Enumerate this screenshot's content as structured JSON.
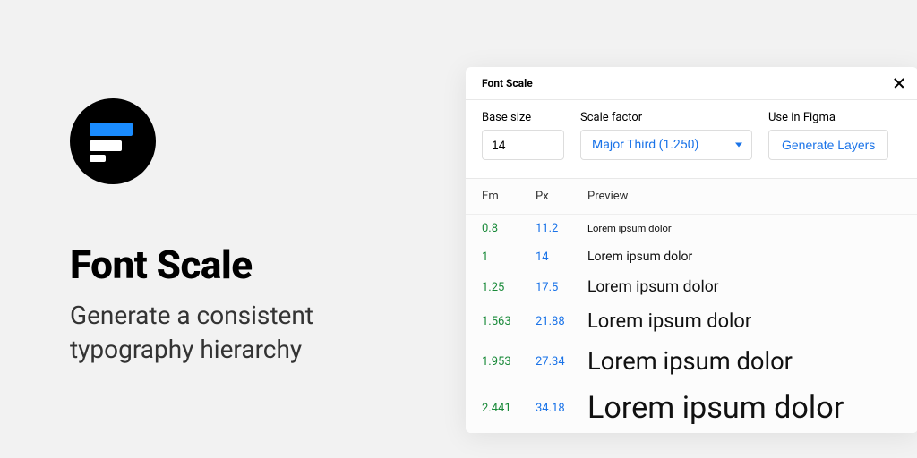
{
  "hero": {
    "title": "Font Scale",
    "subtitle": "Generate a consistent typography hierarchy"
  },
  "plugin": {
    "title": "Font Scale",
    "controls": {
      "base_label": "Base size",
      "base_value": "14",
      "scale_label": "Scale factor",
      "scale_value": "Major Third (1.250)",
      "use_label": "Use in Figma",
      "generate_label": "Generate Layers"
    },
    "columns": {
      "em": "Em",
      "px": "Px",
      "preview": "Preview"
    },
    "rows": [
      {
        "em": "0.8",
        "px": "11.2",
        "preview": "Lorem ipsum dolor",
        "size": 11.2
      },
      {
        "em": "1",
        "px": "14",
        "preview": "Lorem ipsum dolor",
        "size": 14
      },
      {
        "em": "1.25",
        "px": "17.5",
        "preview": "Lorem ipsum dolor",
        "size": 17.5
      },
      {
        "em": "1.563",
        "px": "21.88",
        "preview": "Lorem ipsum dolor",
        "size": 21.88
      },
      {
        "em": "1.953",
        "px": "27.34",
        "preview": "Lorem ipsum dolor",
        "size": 27.34
      },
      {
        "em": "2.441",
        "px": "34.18",
        "preview": "Lorem ipsum dolor",
        "size": 34.18
      }
    ]
  }
}
